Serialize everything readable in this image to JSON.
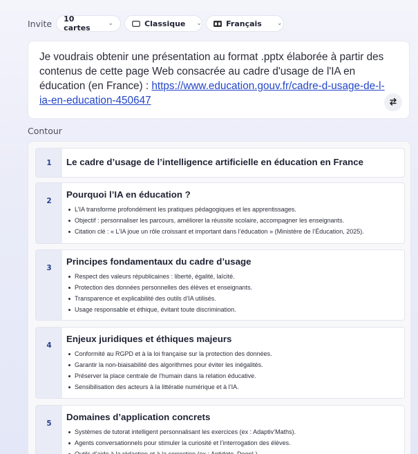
{
  "toolbar": {
    "invite_label": "Invite",
    "cards_value": "10 cartes",
    "style_value": "Classique",
    "language_value": "Français"
  },
  "prompt": {
    "text": "Je voudrais obtenir une présentation au format .pptx élaborée à partir des contenus de cette page Web consacrée au cadre d'usage de l'IA en éducation (en France) : ",
    "link": "https://www.education.gouv.fr/cadre-d-usage-de-l-ia-en-education-450647"
  },
  "outline": {
    "label": "Contour",
    "cards": [
      {
        "number": "1",
        "title": "Le cadre d’usage de l’intelligence artificielle en éducation en France",
        "bullets": []
      },
      {
        "number": "2",
        "title": "Pourquoi l’IA en éducation ?",
        "bullets": [
          "L’IA transforme profondément les pratiques pédagogiques et les apprentissages.",
          "Objectif : personnaliser les parcours, améliorer la réussite scolaire, accompagner les enseignants.",
          "Citation clé : « L’IA joue un rôle croissant et important dans l’éducation » (Ministère de l’Éducation, 2025)."
        ]
      },
      {
        "number": "3",
        "title": "Principes fondamentaux du cadre d’usage",
        "bullets": [
          "Respect des valeurs républicaines : liberté, égalité, laïcité.",
          "Protection des données personnelles des élèves et enseignants.",
          "Transparence et explicabilité des outils d’IA utilisés.",
          "Usage responsable et éthique, évitant toute discrimination."
        ]
      },
      {
        "number": "4",
        "title": "Enjeux juridiques et éthiques majeurs",
        "bullets": [
          "Conformité au RGPD et à la loi française sur la protection des données.",
          "Garantir la non-biaisabilité des algorithmes pour éviter les inégalités.",
          "Préserver la place centrale de l’humain dans la relation éducative.",
          "Sensibilisation des acteurs à la littératie numérique et à l’IA."
        ]
      },
      {
        "number": "5",
        "title": "Domaines d’application concrets",
        "bullets": [
          "Systèmes de tutorat intelligent personnalisant les exercices (ex : Adaptiv’Maths).",
          "Agents conversationnels pour stimuler la curiosité et l’interrogation des élèves.",
          "Outils d’aide à la rédaction et à la correction (ex : Antidote, DeepL)."
        ]
      }
    ]
  }
}
